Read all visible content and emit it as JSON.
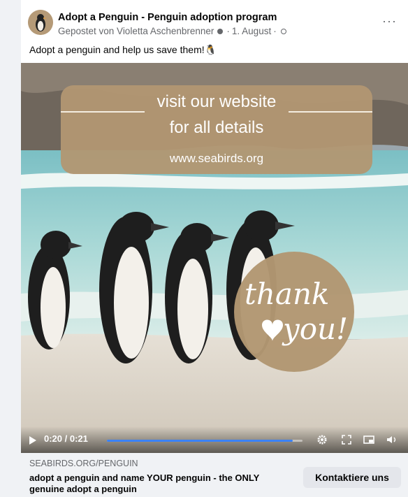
{
  "post": {
    "page_name": "Adopt a Penguin - Penguin adoption program",
    "posted_by": "Gepostet von Violetta Aschenbrenner",
    "date": "1. August",
    "separator": "·",
    "more_label": "···",
    "caption": "Adopt a penguin and help us save them!🐧"
  },
  "media": {
    "banner_line1": "visit our website",
    "banner_line2": "for all details",
    "banner_url": "www.seabirds.org",
    "thanks_word1": "thank",
    "thanks_word2": "you!"
  },
  "video": {
    "time": "0:20 / 0:21",
    "progress": 0.95,
    "accent": "#3b82f6"
  },
  "link_preview": {
    "domain": "SEABIRDS.ORG/PENGUIN",
    "title": "adopt a penguin and name YOUR penguin - the ONLY genuine adopt a penguin",
    "cta_label": "Kontaktiere uns"
  },
  "colors": {
    "brand_tan": "#b29772",
    "meta_gray": "#65676b"
  }
}
